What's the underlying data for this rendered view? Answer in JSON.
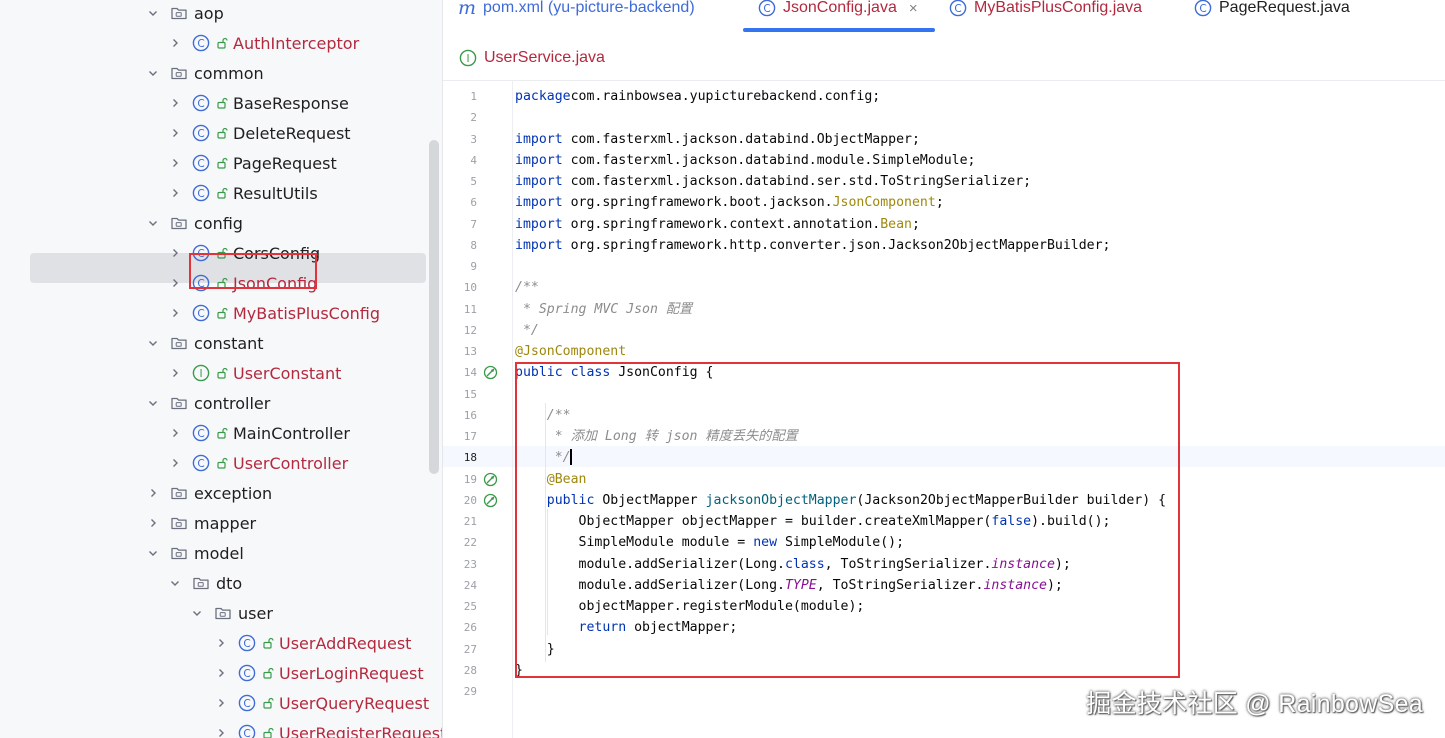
{
  "project_tree": {
    "items": [
      {
        "label": "aop",
        "kind": "folder",
        "depth": 1,
        "expanded": true,
        "color": "dark"
      },
      {
        "label": "AuthInterceptor",
        "kind": "class",
        "depth": 2,
        "color": "red"
      },
      {
        "label": "common",
        "kind": "folder",
        "depth": 1,
        "expanded": true,
        "color": "dark"
      },
      {
        "label": "BaseResponse",
        "kind": "class",
        "depth": 2,
        "color": "dark"
      },
      {
        "label": "DeleteRequest",
        "kind": "class",
        "depth": 2,
        "color": "dark"
      },
      {
        "label": "PageRequest",
        "kind": "class",
        "depth": 2,
        "color": "dark"
      },
      {
        "label": "ResultUtils",
        "kind": "class",
        "depth": 2,
        "color": "dark"
      },
      {
        "label": "config",
        "kind": "folder",
        "depth": 1,
        "expanded": true,
        "color": "dark"
      },
      {
        "label": "CorsConfig",
        "kind": "class",
        "depth": 2,
        "color": "dark"
      },
      {
        "label": "JsonConfig",
        "kind": "class",
        "depth": 2,
        "color": "red",
        "selected": true
      },
      {
        "label": "MyBatisPlusConfig",
        "kind": "class",
        "depth": 2,
        "color": "red"
      },
      {
        "label": "constant",
        "kind": "folder",
        "depth": 1,
        "expanded": true,
        "color": "dark"
      },
      {
        "label": "UserConstant",
        "kind": "interface",
        "depth": 2,
        "color": "red"
      },
      {
        "label": "controller",
        "kind": "folder",
        "depth": 1,
        "expanded": true,
        "color": "dark"
      },
      {
        "label": "MainController",
        "kind": "class",
        "depth": 2,
        "color": "dark"
      },
      {
        "label": "UserController",
        "kind": "class",
        "depth": 2,
        "color": "red"
      },
      {
        "label": "exception",
        "kind": "folder",
        "depth": 1,
        "expanded": false,
        "color": "dark"
      },
      {
        "label": "mapper",
        "kind": "folder",
        "depth": 1,
        "expanded": false,
        "color": "dark"
      },
      {
        "label": "model",
        "kind": "folder",
        "depth": 1,
        "expanded": true,
        "color": "dark"
      },
      {
        "label": "dto",
        "kind": "folder",
        "depth": 2,
        "expanded": true,
        "color": "dark"
      },
      {
        "label": "user",
        "kind": "folder",
        "depth": 3,
        "expanded": true,
        "color": "dark"
      },
      {
        "label": "UserAddRequest",
        "kind": "class",
        "depth": 4,
        "color": "red"
      },
      {
        "label": "UserLoginRequest",
        "kind": "class",
        "depth": 4,
        "color": "red"
      },
      {
        "label": "UserQueryRequest",
        "kind": "class",
        "depth": 4,
        "color": "red"
      },
      {
        "label": "UserRegisterRequest",
        "kind": "class",
        "depth": 4,
        "color": "red"
      }
    ]
  },
  "tabs": {
    "row1": [
      {
        "label": "pom.xml (yu-picture-backend)",
        "icon": "maven-icon",
        "color": "#3f6bd6"
      },
      {
        "label": "JsonConfig.java",
        "icon": "class-icon",
        "color": "#b3293e",
        "active": true,
        "closable": true
      },
      {
        "label": "MyBatisPlusConfig.java",
        "icon": "class-icon",
        "color": "#b3293e"
      },
      {
        "label": "PageRequest.java",
        "icon": "class-icon",
        "color": "#1f1f1f"
      }
    ],
    "row2": [
      {
        "label": "UserService.java",
        "icon": "interface-icon",
        "color": "#b3293e"
      }
    ],
    "close_glyph": "×"
  },
  "editor": {
    "current_line": 18,
    "lines": [
      {
        "n": "1",
        "tokens": [
          [
            "kw",
            "package"
          ],
          [
            "",
            "com.rainbowsea.yupicturebackend.config;"
          ]
        ]
      },
      {
        "n": "2",
        "tokens": []
      },
      {
        "n": "3",
        "tokens": [
          [
            "kw",
            "import"
          ],
          [
            "",
            " com.fasterxml.jackson.databind.ObjectMapper;"
          ]
        ]
      },
      {
        "n": "4",
        "tokens": [
          [
            "kw",
            "import"
          ],
          [
            "",
            " com.fasterxml.jackson.databind.module.SimpleModule;"
          ]
        ]
      },
      {
        "n": "5",
        "tokens": [
          [
            "kw",
            "import"
          ],
          [
            "",
            " com.fasterxml.jackson.databind.ser.std.ToStringSerializer;"
          ]
        ]
      },
      {
        "n": "6",
        "tokens": [
          [
            "kw",
            "import"
          ],
          [
            "",
            " org.springframework.boot.jackson."
          ],
          [
            "an",
            "JsonComponent"
          ],
          [
            "",
            ";"
          ]
        ]
      },
      {
        "n": "7",
        "tokens": [
          [
            "kw",
            "import"
          ],
          [
            "",
            " org.springframework.context.annotation."
          ],
          [
            "an",
            "Bean"
          ],
          [
            "",
            ";"
          ]
        ]
      },
      {
        "n": "8",
        "tokens": [
          [
            "kw",
            "import"
          ],
          [
            "",
            " org.springframework.http.converter.json.Jackson2ObjectMapperBuilder;"
          ]
        ]
      },
      {
        "n": "9",
        "tokens": []
      },
      {
        "n": "10",
        "tokens": [
          [
            "cm",
            "/**"
          ]
        ]
      },
      {
        "n": "11",
        "tokens": [
          [
            "cm",
            " * Spring MVC Json 配置"
          ]
        ]
      },
      {
        "n": "12",
        "tokens": [
          [
            "cm",
            " */"
          ]
        ]
      },
      {
        "n": "13",
        "tokens": [
          [
            "an",
            "@JsonComponent"
          ]
        ]
      },
      {
        "n": "14",
        "tokens": [
          [
            "kw",
            "public class"
          ],
          [
            "",
            " JsonConfig {"
          ]
        ],
        "gutter": "bean-icon"
      },
      {
        "n": "15",
        "tokens": []
      },
      {
        "n": "16",
        "tokens": [
          [
            "cm",
            "    /**"
          ]
        ]
      },
      {
        "n": "17",
        "tokens": [
          [
            "cm",
            "     * 添加 Long 转 json 精度丢失的配置"
          ]
        ]
      },
      {
        "n": "18",
        "tokens": [
          [
            "cm",
            "     */"
          ]
        ]
      },
      {
        "n": "19",
        "tokens": [
          [
            "an",
            "    @Bean"
          ]
        ],
        "gutter": "bean-icon"
      },
      {
        "n": "20",
        "tokens": [
          [
            "kw",
            "    public"
          ],
          [
            "",
            " ObjectMapper "
          ],
          [
            "fn",
            "jacksonObjectMapper"
          ],
          [
            "",
            "(Jackson2ObjectMapperBuilder builder) {"
          ]
        ],
        "gutter": "bean-icon"
      },
      {
        "n": "21",
        "tokens": [
          [
            "",
            "        ObjectMapper objectMapper = builder.createXmlMapper("
          ],
          [
            "kw",
            "false"
          ],
          [
            "",
            ").build();"
          ]
        ]
      },
      {
        "n": "22",
        "tokens": [
          [
            "",
            "        SimpleModule module = "
          ],
          [
            "kw",
            "new"
          ],
          [
            "",
            " SimpleModule();"
          ]
        ]
      },
      {
        "n": "23",
        "tokens": [
          [
            "",
            "        module.addSerializer(Long."
          ],
          [
            "kw",
            "class"
          ],
          [
            "",
            ", ToStringSerializer."
          ],
          [
            "st",
            "instance"
          ],
          [
            "",
            ");"
          ]
        ]
      },
      {
        "n": "24",
        "tokens": [
          [
            "",
            "        module.addSerializer(Long."
          ],
          [
            "st",
            "TYPE"
          ],
          [
            "",
            ", ToStringSerializer."
          ],
          [
            "st",
            "instance"
          ],
          [
            "",
            ");"
          ]
        ]
      },
      {
        "n": "25",
        "tokens": [
          [
            "",
            "        objectMapper.registerModule(module);"
          ]
        ]
      },
      {
        "n": "26",
        "tokens": [
          [
            "kw",
            "        return"
          ],
          [
            "",
            " objectMapper;"
          ]
        ]
      },
      {
        "n": "27",
        "tokens": [
          [
            "",
            "    }"
          ]
        ]
      },
      {
        "n": "28",
        "tokens": [
          [
            "",
            "}"
          ]
        ]
      },
      {
        "n": "29",
        "tokens": []
      }
    ]
  },
  "colors": {
    "accent": "#3574f0",
    "highlight_box": "#e0343a",
    "modified_red": "#b3293e",
    "class_icon": "#3f6bd6",
    "interface_icon": "#3a9a4a"
  },
  "watermark": "掘金技术社区 @ RainbowSea"
}
